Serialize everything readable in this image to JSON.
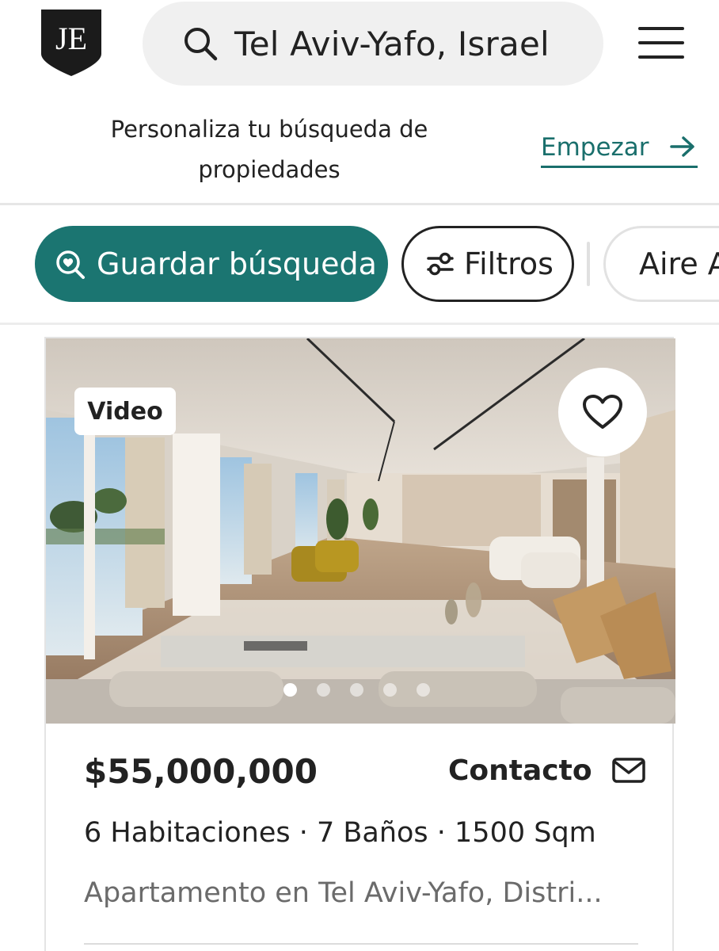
{
  "header": {
    "logo_text": "JE",
    "search_text": "Tel Aviv-Yafo, Israel",
    "search_icon": "search-icon",
    "menu_icon": "hamburger-menu-icon"
  },
  "banner": {
    "text": "Personaliza tu búsqueda de propiedades",
    "link_label": "Empezar",
    "link_icon": "arrow-right-icon",
    "accent_color": "#1a6f6c"
  },
  "chips": [
    {
      "label": "Guardar búsqueda",
      "icon": "search-heart-icon",
      "style": "filled",
      "color": "#1b7571"
    },
    {
      "label": "Filtros",
      "icon": "sliders-icon",
      "style": "outlined"
    },
    {
      "label": "Aire A",
      "icon": "",
      "style": "outlined-light"
    }
  ],
  "listing": {
    "badge": "Video",
    "favorite_icon": "heart-outline-icon",
    "carousel": {
      "count": 5,
      "active": 1
    },
    "price": "$55,000,000",
    "contact_label": "Contacto",
    "contact_icon": "envelope-icon",
    "specs": "6 Habitaciones · 7 Baños · 1500 Sqm",
    "address": "Apartamento en Tel Aviv-Yafo, Distri..."
  }
}
